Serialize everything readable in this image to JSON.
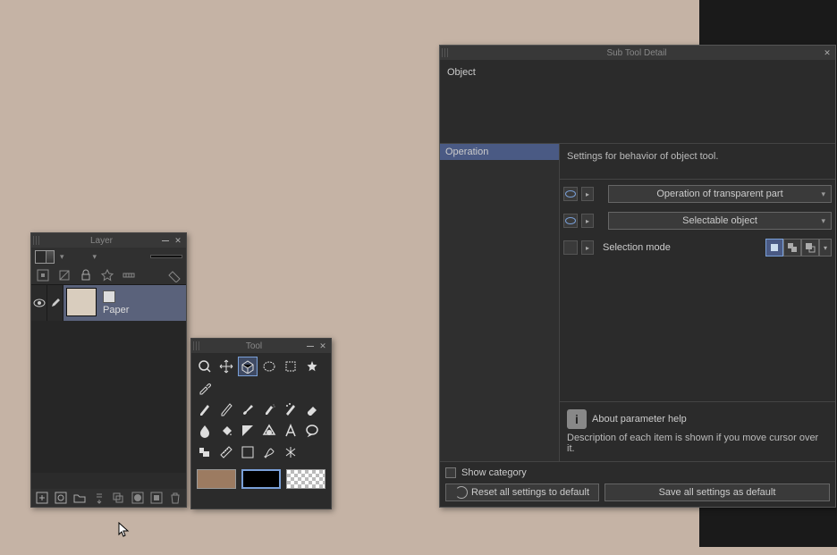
{
  "layer_panel": {
    "title": "Layer",
    "layers": [
      {
        "name": "Paper"
      }
    ]
  },
  "tool_panel": {
    "title": "Tool",
    "colors": {
      "fg": "#9c7b61",
      "bg": "#000000"
    }
  },
  "detail_panel": {
    "title": "Sub Tool Detail",
    "header": "Object",
    "categories": [
      {
        "label": "Operation",
        "selected": true
      }
    ],
    "settings_desc": "Settings for behavior of object tool.",
    "rows": {
      "transparent": {
        "label": "Operation of transparent part"
      },
      "selectable": {
        "label": "Selectable object"
      },
      "selection_mode": {
        "label": "Selection mode"
      }
    },
    "help": {
      "title": "About parameter help",
      "body": "Description of each item is shown if you move cursor over it."
    },
    "show_category": "Show category",
    "reset_btn": "Reset all settings to default",
    "save_btn": "Save all settings as default"
  }
}
